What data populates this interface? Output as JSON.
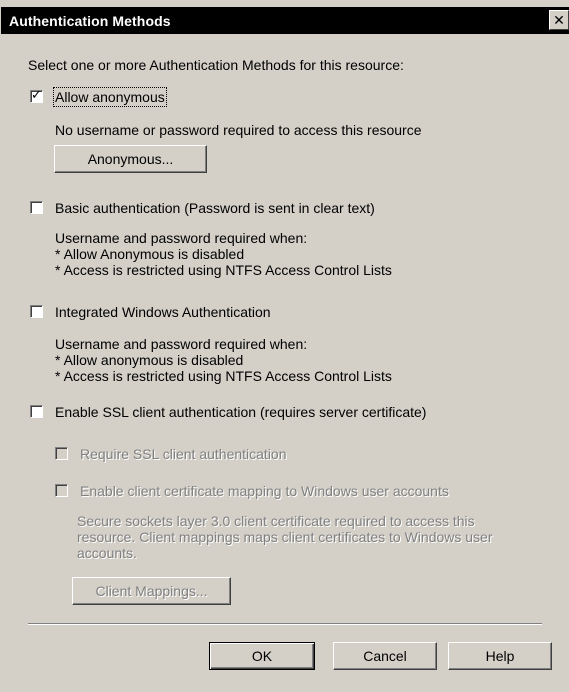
{
  "window": {
    "title": "Authentication Methods",
    "close_icon": "close-icon"
  },
  "intro": "Select one or more Authentication Methods for this resource:",
  "anonymous": {
    "label": "Allow anonymous",
    "checked": true,
    "description": "No username or password required to access this resource",
    "button": "Anonymous..."
  },
  "basic": {
    "label": "Basic authentication (Password is sent in clear text)",
    "checked": false,
    "desc_line1": "Username and password required when:",
    "desc_line2": "* Allow Anonymous is disabled",
    "desc_line3": "* Access is restricted using NTFS Access Control Lists"
  },
  "integrated": {
    "label": "Integrated Windows Authentication",
    "checked": false,
    "desc_line1": "Username and password required when:",
    "desc_line2": "* Allow anonymous is disabled",
    "desc_line3": "* Access is restricted using NTFS Access Control Lists"
  },
  "ssl": {
    "label": "Enable SSL client authentication (requires server certificate)",
    "checked": false,
    "require_label": "Require SSL client authentication",
    "mapping_label": "Enable client certificate mapping to Windows user accounts",
    "desc_line1": "Secure sockets layer 3.0 client certificate required to access this",
    "desc_line2": "resource.  Client mappings maps client certificates to Windows user",
    "desc_line3": "accounts.",
    "button": "Client Mappings..."
  },
  "footer": {
    "ok": "OK",
    "cancel": "Cancel",
    "help": "Help"
  }
}
